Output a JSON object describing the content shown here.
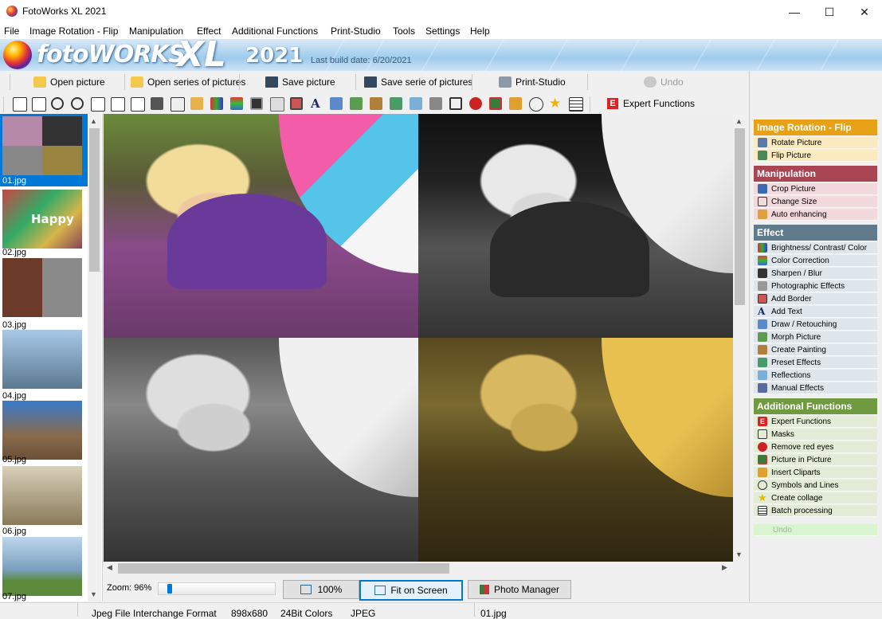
{
  "window": {
    "title": "FotoWorks XL 2021",
    "minimize": "—",
    "maximize": "☐",
    "close": "✕"
  },
  "menu": [
    "File",
    "Image Rotation - Flip",
    "Manipulation",
    "Effect",
    "Additional Functions",
    "Print-Studio",
    "Tools",
    "Settings",
    "Help"
  ],
  "banner": {
    "logo_foto": "fotoWORKS",
    "logo_xl": "XL",
    "logo_year": "2021",
    "build_date": "Last build date: 6/20/2021"
  },
  "toolbar": {
    "open_picture": "Open picture",
    "open_series": "Open series of pictures",
    "save_picture": "Save picture",
    "save_series": "Save serie of pictures",
    "print_studio": "Print-Studio",
    "undo": "Undo",
    "expert_functions": "Expert Functions",
    "expert_icon": "E"
  },
  "thumbnails": [
    {
      "label": "01.jpg",
      "selected": true
    },
    {
      "label": "02.jpg",
      "selected": false
    },
    {
      "label": "03.jpg",
      "selected": false
    },
    {
      "label": "04.jpg",
      "selected": false
    },
    {
      "label": "05.jpg",
      "selected": false
    },
    {
      "label": "06.jpg",
      "selected": false
    },
    {
      "label": "07.jpg",
      "selected": false
    }
  ],
  "zoom": {
    "label": "Zoom: 96%",
    "level_percent": 96,
    "btn_100": "100%",
    "btn_fit": "Fit on Screen",
    "btn_manager": "Photo Manager"
  },
  "sections": [
    {
      "title": "Image Rotation - Flip",
      "head_color": "#e6a117",
      "item_color": "#fbe9bf",
      "items": [
        "Rotate Picture",
        "Flip Picture"
      ]
    },
    {
      "title": "Manipulation",
      "head_color": "#a94552",
      "item_color": "#f2d9dc",
      "items": [
        "Crop Picture",
        "Change Size",
        "Auto enhancing"
      ]
    },
    {
      "title": "Effect",
      "head_color": "#5f7b8c",
      "item_color": "#dfe6eb",
      "items": [
        "Brightness/ Contrast/ Color",
        "Color Correction",
        "Sharpen / Blur",
        "Photographic Effects",
        "Add Border",
        "Add Text",
        "Draw / Retouching",
        "Morph Picture",
        "Create Painting",
        "Preset Effects",
        "Reflections",
        "Manual Effects"
      ]
    },
    {
      "title": "Additional Functions",
      "head_color": "#6f9a3f",
      "item_color": "#e2ecd6",
      "items": [
        "Expert Functions",
        "Masks",
        "Remove red eyes",
        "Picture in Picture",
        "Insert Cliparts",
        "Symbols and Lines",
        "Create collage",
        "Batch processing"
      ]
    }
  ],
  "panel_undo": "Undo",
  "status": {
    "format": "Jpeg File Interchange Format",
    "dimensions": "898x680",
    "colors": "24Bit Colors",
    "type": "JPEG",
    "filename": "01.jpg"
  }
}
